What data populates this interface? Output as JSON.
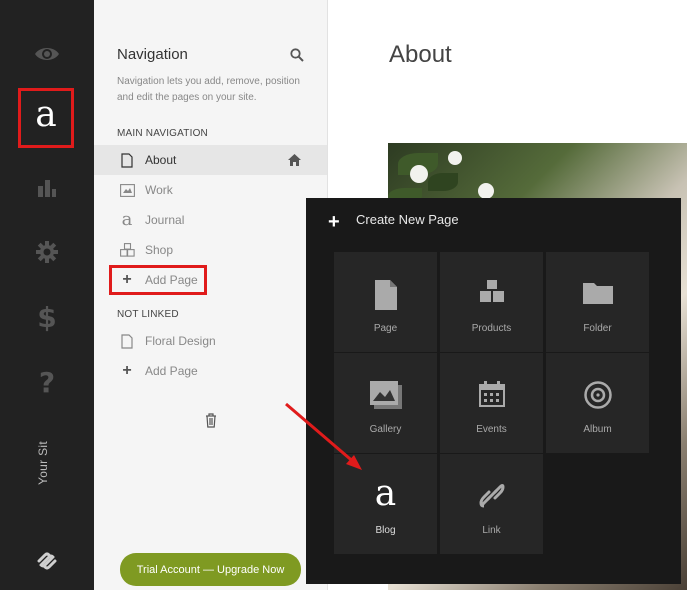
{
  "rail": {
    "site_label": "Your Sit",
    "icons": [
      "eye-icon",
      "logo-a-icon",
      "analytics-icon",
      "gear-icon",
      "dollar-icon",
      "help-icon",
      "squarespace-logo-icon"
    ],
    "logo_glyph": "a"
  },
  "nav": {
    "title": "Navigation",
    "description": "Navigation lets you add, remove, position and edit the pages on your site.",
    "main_section": "MAIN NAVIGATION",
    "main_items": [
      {
        "label": "About",
        "icon": "page-icon",
        "active": true
      },
      {
        "label": "Work",
        "icon": "gallery-icon"
      },
      {
        "label": "Journal",
        "icon": "blog-icon"
      },
      {
        "label": "Shop",
        "icon": "products-icon"
      },
      {
        "label": "Add Page",
        "icon": "plus-icon"
      }
    ],
    "unlinked_section": "NOT LINKED",
    "unlinked_items": [
      {
        "label": "Floral Design",
        "icon": "page-icon"
      },
      {
        "label": "Add Page",
        "icon": "plus-icon"
      }
    ],
    "trial_button": "Trial Account — Upgrade Now"
  },
  "main": {
    "title": "About"
  },
  "popup": {
    "title": "Create New Page",
    "tiles": [
      {
        "label": "Page",
        "icon": "page-icon"
      },
      {
        "label": "Products",
        "icon": "products-icon"
      },
      {
        "label": "Folder",
        "icon": "folder-icon"
      },
      {
        "label": "Gallery",
        "icon": "gallery-icon"
      },
      {
        "label": "Events",
        "icon": "calendar-icon"
      },
      {
        "label": "Album",
        "icon": "album-icon"
      },
      {
        "label": "Blog",
        "icon": "blog-icon",
        "glyph": "a"
      },
      {
        "label": "Link",
        "icon": "link-icon"
      }
    ]
  },
  "colors": {
    "rail_bg": "#222222",
    "highlight_red": "#e01b1b",
    "trial_green": "#7f9a22",
    "popup_bg": "#191919",
    "tile_bg": "#262626"
  }
}
